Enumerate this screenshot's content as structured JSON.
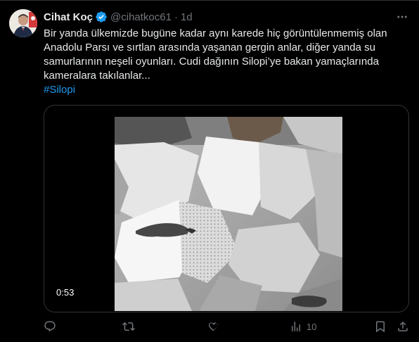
{
  "author": {
    "name": "Cihat Koç",
    "handle": "@cihatkoc61",
    "separator": "·",
    "time": "1d",
    "verified_color": "#1d9bf0"
  },
  "tweet": {
    "text": "Bir yanda ülkemizde bugüne kadar aynı karede hiç görüntülenmemiş olan Anadolu Parsı ve sırtlan arasında yaşanan gergin anlar, diğer yanda su samurlarının neşeli oyunları. Cudi dağının Silopi’ye bakan yamaçlarında kameralara takılanlar...",
    "hashtag": "#Silopi",
    "hashtag_color": "#1d9bf0"
  },
  "media": {
    "duration": "0:53"
  },
  "actions": {
    "reply_icon": "reply-icon",
    "retweet_icon": "retweet-icon",
    "like_icon": "like-icon",
    "views_icon": "views-icon",
    "views_count": "10",
    "bookmark_icon": "bookmark-icon",
    "share_icon": "share-icon"
  },
  "colors": {
    "background": "#000000",
    "text": "#e7e9ea",
    "muted": "#71767b",
    "border": "#2f3336"
  }
}
